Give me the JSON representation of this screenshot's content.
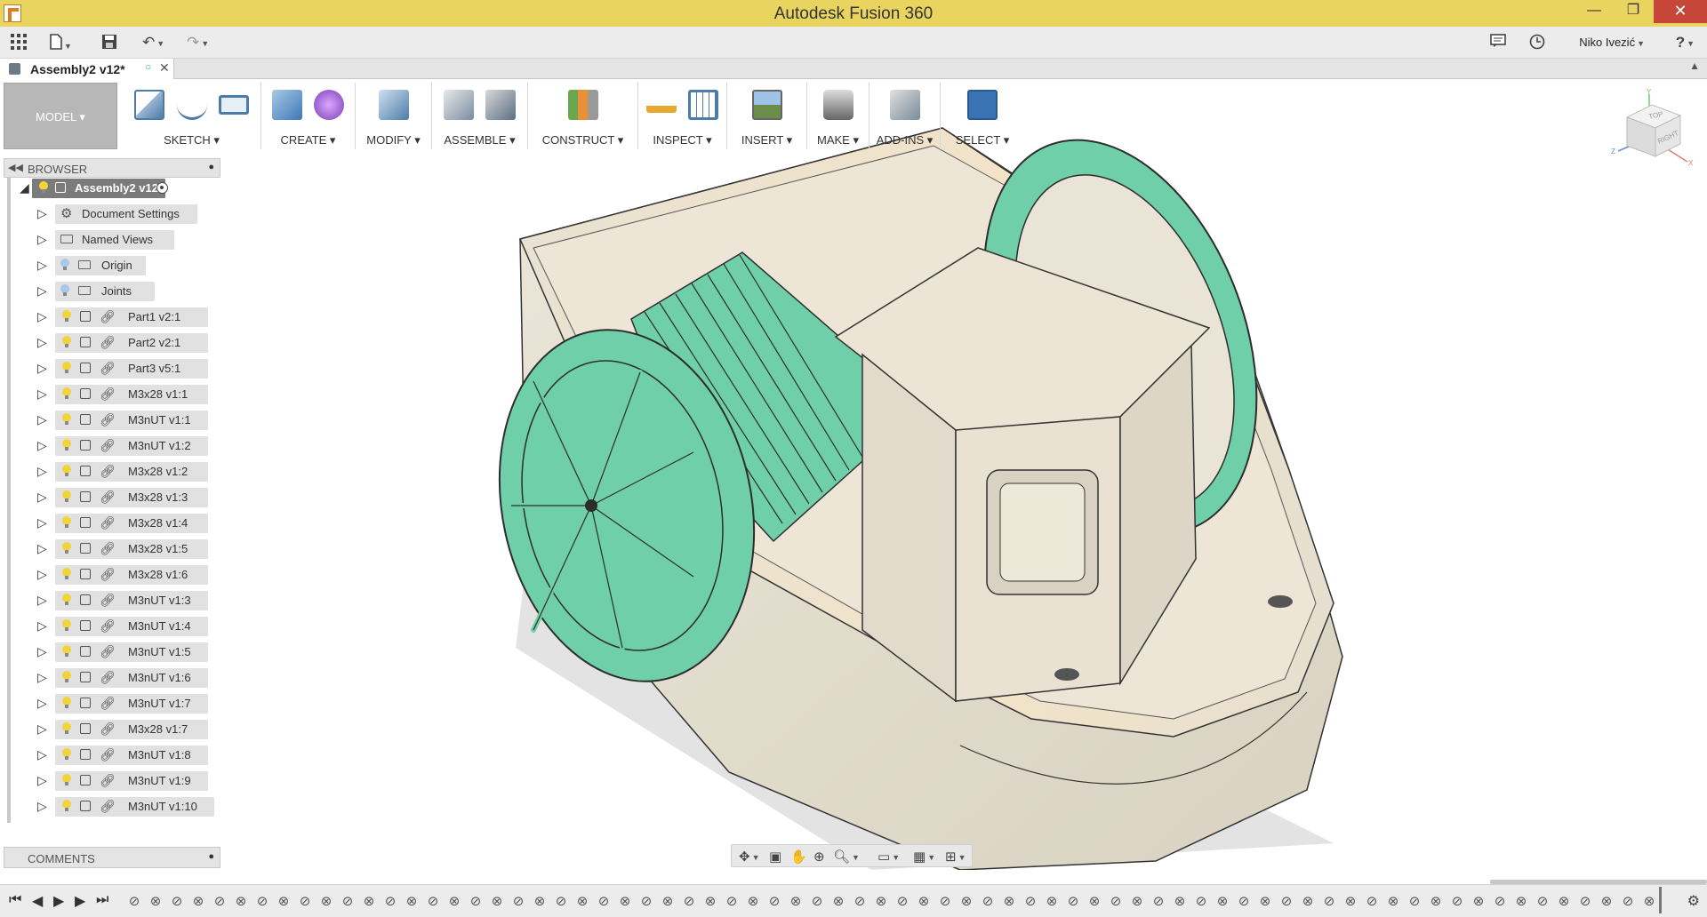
{
  "window": {
    "title": "Autodesk Fusion 360",
    "minimize": "—",
    "restore": "❐",
    "close": "✕"
  },
  "quickbar": {
    "user": "Niko Ivezić",
    "help": "?"
  },
  "tab": {
    "label": "Assembly2 v12*",
    "status": "○",
    "close": "✕"
  },
  "workspace": {
    "label": "MODEL ▾"
  },
  "toolbar": {
    "groups": [
      {
        "label": "SKETCH ▾"
      },
      {
        "label": "CREATE ▾"
      },
      {
        "label": "MODIFY ▾"
      },
      {
        "label": "ASSEMBLE ▾"
      },
      {
        "label": "CONSTRUCT ▾"
      },
      {
        "label": "INSPECT ▾"
      },
      {
        "label": "INSERT ▾"
      },
      {
        "label": "MAKE ▾"
      },
      {
        "label": "ADD-INS ▾"
      },
      {
        "label": "SELECT ▾"
      }
    ]
  },
  "browser": {
    "title": "BROWSER",
    "root": "Assembly2 v12",
    "items": [
      {
        "label": "Document Settings"
      },
      {
        "label": "Named Views"
      },
      {
        "label": "Origin"
      },
      {
        "label": "Joints"
      },
      {
        "label": "Part1 v2:1"
      },
      {
        "label": "Part2 v2:1"
      },
      {
        "label": "Part3 v5:1"
      },
      {
        "label": "M3x28 v1:1"
      },
      {
        "label": "M3nUT v1:1"
      },
      {
        "label": "M3nUT v1:2"
      },
      {
        "label": "M3x28 v1:2"
      },
      {
        "label": "M3x28 v1:3"
      },
      {
        "label": "M3x28 v1:4"
      },
      {
        "label": "M3x28 v1:5"
      },
      {
        "label": "M3x28 v1:6"
      },
      {
        "label": "M3nUT v1:3"
      },
      {
        "label": "M3nUT v1:4"
      },
      {
        "label": "M3nUT v1:5"
      },
      {
        "label": "M3nUT v1:6"
      },
      {
        "label": "M3nUT v1:7"
      },
      {
        "label": "M3x28 v1:7"
      },
      {
        "label": "M3nUT v1:8"
      },
      {
        "label": "M3nUT v1:9"
      },
      {
        "label": "M3nUT v1:10"
      }
    ]
  },
  "comments": {
    "title": "COMMENTS"
  },
  "viewcube": {
    "top": "TOP",
    "right": "RIGHT",
    "axis_x": "X",
    "axis_y": "Y",
    "axis_z": "Z"
  },
  "colors": {
    "accent": "#3a73b3",
    "paddle": "#6fcfa8",
    "hull": "#e5dfd1",
    "titlebar": "#e8d45e"
  }
}
